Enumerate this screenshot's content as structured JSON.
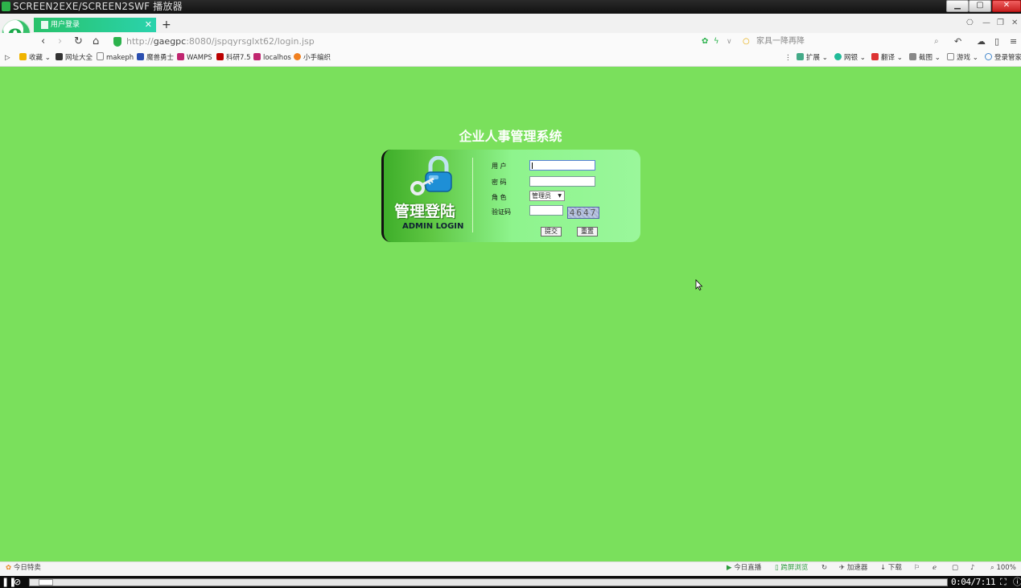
{
  "player": {
    "title": "SCREEN2EXE/SCREEN2SWF 播放器",
    "time": "0:04/7:11",
    "progress_fraction": 0.009
  },
  "browser": {
    "active_tab": "用户登录",
    "url_gray_prefix": "http://",
    "url_host": "gaegpc",
    "url_rest": ":8080/jspqyrsglxt62/login.jsp",
    "search_placeholder": "家具一降再降",
    "bookmarks": [
      "收藏",
      "网址大全",
      "makeph",
      "魔兽勇士",
      "WAMPS",
      "科研7.5",
      "localhos",
      "小手编织"
    ],
    "toolbar_right": [
      "扩展",
      "网银",
      "翻译",
      "截图",
      "游戏",
      "登录管家"
    ],
    "status_left": "今日特卖",
    "status_right": [
      "今日直播",
      "跨屏浏览",
      "加速器",
      "下载",
      "100%"
    ]
  },
  "page": {
    "title": "企业人事管理系统",
    "admin_cn": "管理登陆",
    "admin_en": "ADMIN LOGIN",
    "user_label": "用  户",
    "password_label": "密  码",
    "role_label": "角  色",
    "captcha_label": "验证码",
    "role_selected": "管理员",
    "captcha_text": "4647",
    "submit_label": "提交",
    "reset_label": "重置",
    "user_value": "",
    "password_value": "",
    "captcha_value": ""
  },
  "colors": {
    "page_background": "#7ae05c",
    "panel_dark": "#3eae2a",
    "panel_light": "#9af79b",
    "tab_active": "#28c26a"
  }
}
